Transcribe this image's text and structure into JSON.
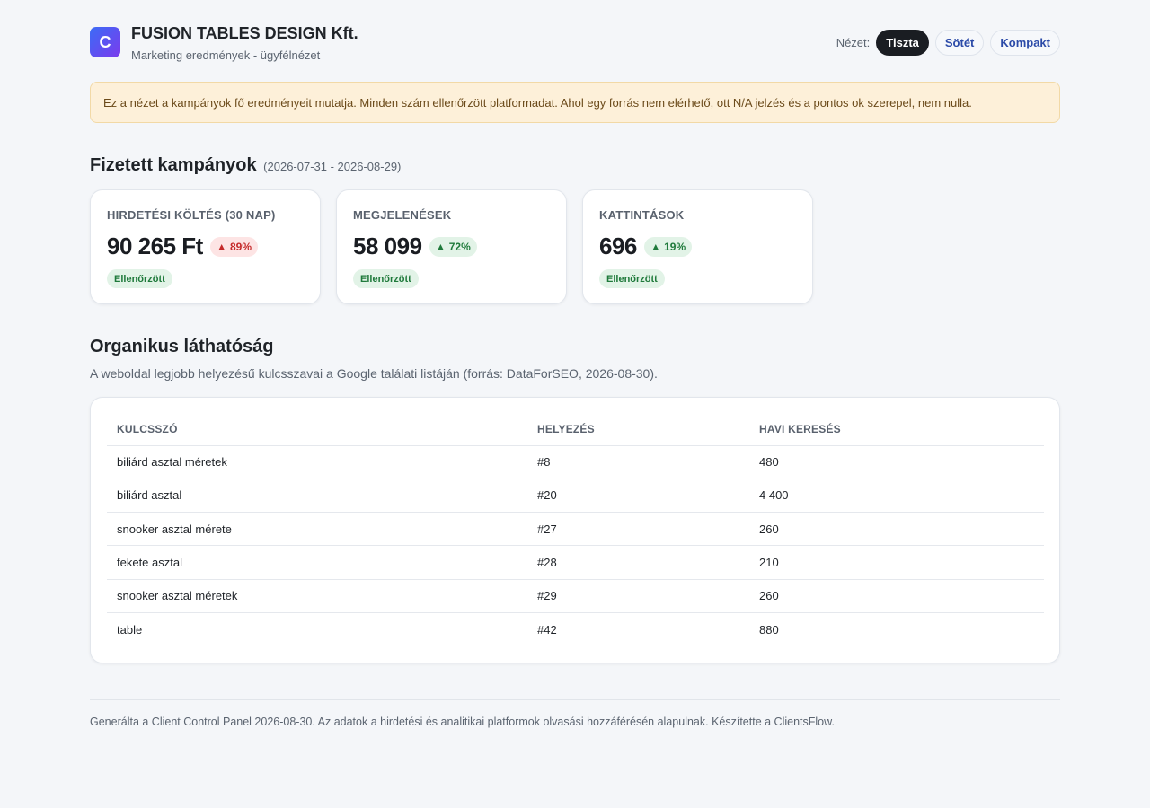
{
  "header": {
    "logo_letter": "C",
    "company": "FUSION TABLES DESIGN Kft.",
    "subtitle": "Marketing eredmények - ügyfélnézet",
    "view_label": "Nézet:",
    "views": [
      {
        "label": "Tiszta",
        "active": true
      },
      {
        "label": "Sötét",
        "active": false
      },
      {
        "label": "Kompakt",
        "active": false
      }
    ]
  },
  "notice": "Ez a nézet a kampányok fő eredményeit mutatja. Minden szám ellenőrzött platformadat. Ahol egy forrás nem elérhető, ott N/A jelzés és a pontos ok szerepel, nem nulla.",
  "paid": {
    "title": "Fizetett kampányok",
    "range": "(2026-07-31 - 2026-08-29)",
    "cards": [
      {
        "label": "HIRDETÉSI KÖLTÉS (30 NAP)",
        "value": "90 265 Ft",
        "delta": "▲ 89%",
        "badge": "Ellenőrzött"
      },
      {
        "label": "MEGJELENÉSEK",
        "value": "58 099",
        "delta": "▲ 72%",
        "badge": "Ellenőrzött"
      },
      {
        "label": "KATTINTÁSOK",
        "value": "696",
        "delta": "▲ 19%",
        "badge": "Ellenőrzött"
      }
    ]
  },
  "organic": {
    "title": "Organikus láthatóság",
    "subtitle": "A weboldal legjobb helyezésű kulcsszavai a Google találati listáján (forrás: DataForSEO, 2026-08-30).",
    "columns": [
      "KULCSSZÓ",
      "HELYEZÉS",
      "HAVI KERESÉS"
    ],
    "rows": [
      [
        "biliárd asztal méretek",
        "#8",
        "480"
      ],
      [
        "biliárd asztal",
        "#20",
        "4 400"
      ],
      [
        "snooker asztal mérete",
        "#27",
        "260"
      ],
      [
        "fekete asztal",
        "#28",
        "210"
      ],
      [
        "snooker asztal méretek",
        "#29",
        "260"
      ],
      [
        "table",
        "#42",
        "880"
      ]
    ]
  },
  "footer": "Generálta a Client Control Panel 2026-08-30. Az adatok a hirdetési és analitikai platformok olvasási hozzáférésén alapulnak. Készítette a ClientsFlow.",
  "colors": {
    "accent_start": "#3b6cf6",
    "accent_end": "#7c3aed",
    "delta_bad": "#c52a2a",
    "delta_good": "#1f7a3b",
    "notice_bg": "#fdf0d9"
  }
}
